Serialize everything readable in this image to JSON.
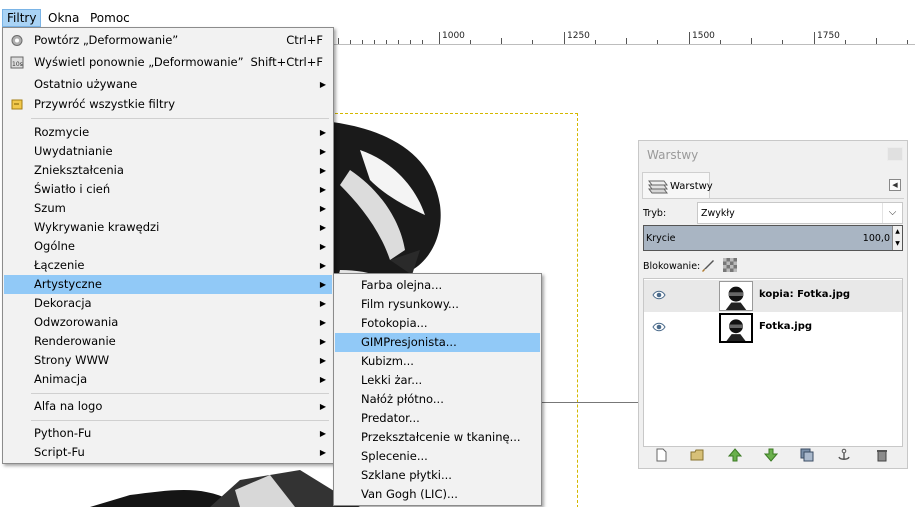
{
  "menubar": {
    "filters": "Filtry",
    "windows": "Okna",
    "help": "Pomoc"
  },
  "ruler": {
    "labels": [
      "1000",
      "1250",
      "1500",
      "1750"
    ]
  },
  "filters_menu": {
    "items": [
      {
        "label": "Powtórz „Deformowanie”",
        "shortcut": "Ctrl+F",
        "icon": "repeat-icon"
      },
      {
        "label": "Wyświetl ponownie „Deformowanie”",
        "shortcut": "Shift+Ctrl+F",
        "icon": "reshow-icon"
      },
      {
        "label": "Ostatnio używane",
        "arrow": "▶"
      },
      {
        "label": "Przywróć wszystkie filtry",
        "icon": "reset-filters-icon"
      },
      {
        "label": "Rozmycie",
        "arrow": "▶"
      },
      {
        "label": "Uwydatnianie",
        "arrow": "▶"
      },
      {
        "label": "Zniekształcenia",
        "arrow": "▶"
      },
      {
        "label": "Światło i cień",
        "arrow": "▶"
      },
      {
        "label": "Szum",
        "arrow": "▶"
      },
      {
        "label": "Wykrywanie krawędzi",
        "arrow": "▶"
      },
      {
        "label": "Ogólne",
        "arrow": "▶"
      },
      {
        "label": "Łączenie",
        "arrow": "▶"
      },
      {
        "label": "Artystyczne",
        "arrow": "▶"
      },
      {
        "label": "Dekoracja",
        "arrow": "▶"
      },
      {
        "label": "Odwzorowania",
        "arrow": "▶"
      },
      {
        "label": "Renderowanie",
        "arrow": "▶"
      },
      {
        "label": "Strony WWW",
        "arrow": "▶"
      },
      {
        "label": "Animacja",
        "arrow": "▶"
      },
      {
        "label": "Alfa na logo",
        "arrow": "▶"
      },
      {
        "label": "Python-Fu",
        "arrow": "▶"
      },
      {
        "label": "Script-Fu",
        "arrow": "▶"
      }
    ]
  },
  "artistic_menu": {
    "items": [
      "Farba olejna...",
      "Film rysunkowy...",
      "Fotokopia...",
      "GIMPresjonista...",
      "Kubizm...",
      "Lekki żar...",
      "Nałóż płótno...",
      "Predator...",
      "Przekształcenie w tkaninę...",
      "Splecenie...",
      "Szklane płytki...",
      "Van Gogh (LIC)..."
    ]
  },
  "layers_dialog": {
    "title": "Warstwy",
    "tab_label": "Warstwy",
    "mode_label": "Tryb:",
    "mode_value": "Zwykły",
    "opacity_label": "Krycie",
    "opacity_value": "100,0",
    "lock_label": "Blokowanie:",
    "layers": [
      {
        "name": "kopia: Fotka.jpg",
        "selected": true
      },
      {
        "name": "Fotka.jpg",
        "selected": false
      }
    ],
    "bottom_icons": [
      "new-layer-icon",
      "new-group-icon",
      "raise-layer-icon",
      "lower-layer-icon",
      "duplicate-layer-icon",
      "anchor-layer-icon",
      "delete-layer-icon"
    ]
  }
}
